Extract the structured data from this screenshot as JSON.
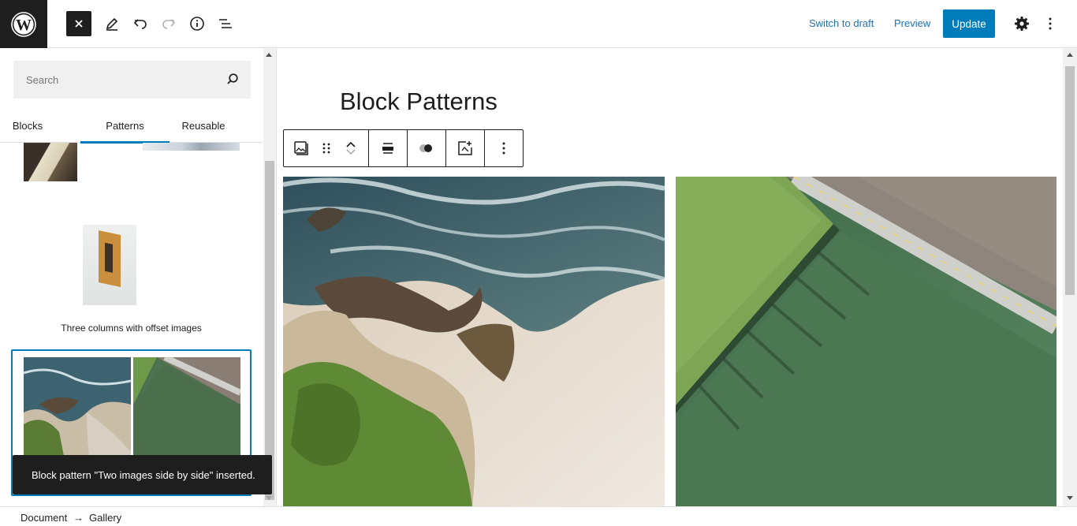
{
  "header": {
    "switch_to_draft": "Switch to draft",
    "preview": "Preview",
    "update": "Update"
  },
  "sidebar": {
    "search_placeholder": "Search",
    "tabs": [
      "Blocks",
      "Patterns",
      "Reusable"
    ],
    "active_tab": "Patterns",
    "pattern_caption": "Three columns with offset images"
  },
  "editor": {
    "title": "Block Patterns"
  },
  "snackbar": {
    "message": "Block pattern \"Two images side by side\" inserted."
  },
  "breadcrumb": [
    "Document",
    "Gallery"
  ],
  "breadcrumb_separator": "→",
  "colors": {
    "accent": "#007cba",
    "dark": "#1e1e1e",
    "link": "#2271b1"
  }
}
